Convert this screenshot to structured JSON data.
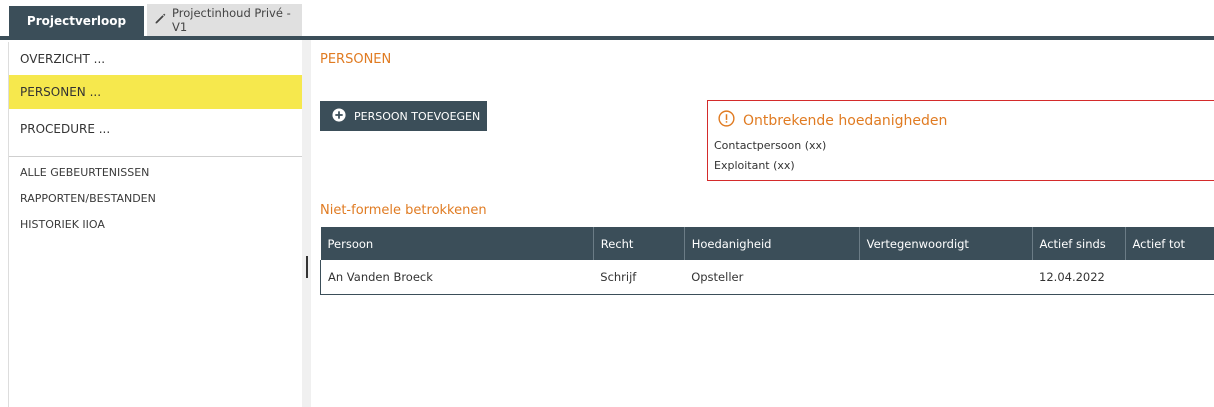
{
  "tabs": {
    "active_label": "Projectverloop",
    "inactive_label": "Projectinhoud Privé - V1",
    "inactive_icon": "pencil-icon"
  },
  "sidebar": {
    "items": [
      {
        "label": "OVERZICHT ..."
      },
      {
        "label": "PERSONEN ..."
      },
      {
        "label": "PROCEDURE ..."
      }
    ],
    "active_index": 1,
    "links": [
      {
        "label": "ALLE GEBEURTENISSEN"
      },
      {
        "label": "RAPPORTEN/BESTANDEN"
      },
      {
        "label": "HISTORIEK IIOA"
      }
    ]
  },
  "main": {
    "title": "PERSONEN",
    "add_button": {
      "label": "PERSOON TOEVOEGEN",
      "icon": "plus-circle-icon"
    },
    "warning": {
      "icon": "alert-circle-icon",
      "title": "Ontbrekende hoedanigheden",
      "lines": [
        "Contactpersoon (xx)",
        "Exploitant (xx)"
      ]
    },
    "subsection_title": "Niet-formele betrokkenen",
    "table": {
      "columns": [
        "Persoon",
        "Recht",
        "Hoedanigheid",
        "Vertegenwoordigt",
        "Actief sinds",
        "Actief tot"
      ],
      "rows": [
        [
          "An Vanden Broeck",
          "Schrijf",
          "Opsteller",
          "",
          "12.04.2022",
          ""
        ]
      ]
    }
  },
  "colors": {
    "accent_orange": "#e07b22",
    "header_dark": "#3b4e59",
    "highlight_yellow": "#f6e84d",
    "warning_red": "#d42b2b"
  }
}
